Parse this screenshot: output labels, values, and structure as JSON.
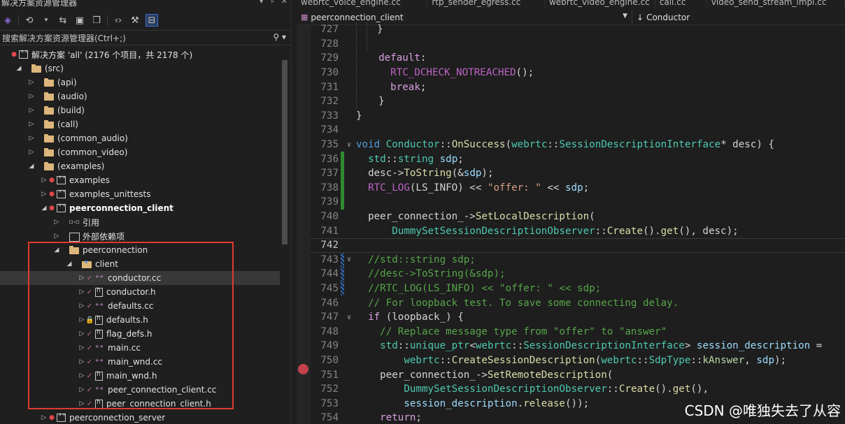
{
  "solution_explorer": {
    "title": "解决方案资源管理器",
    "window_buttons": [
      "▾",
      "♯",
      "✕"
    ],
    "search_placeholder": "搜索解决方案资源管理器(Ctrl+;)",
    "tree": [
      {
        "label": "解决方案 'all' (2176 个项目，共 2178 个)",
        "icon": "solution-icon",
        "status": "red",
        "arrow": "",
        "depth": 0
      },
      {
        "label": "(src)",
        "icon": "folder-icon",
        "status": "",
        "arrow": "open",
        "depth": 1
      },
      {
        "label": "(api)",
        "icon": "folder-icon",
        "status": "",
        "arrow": "closed",
        "depth": 2
      },
      {
        "label": "(audio)",
        "icon": "folder-icon",
        "status": "",
        "arrow": "closed",
        "depth": 2
      },
      {
        "label": "(build)",
        "icon": "folder-icon",
        "status": "",
        "arrow": "closed",
        "depth": 2
      },
      {
        "label": "(call)",
        "icon": "folder-icon",
        "status": "",
        "arrow": "closed",
        "depth": 2
      },
      {
        "label": "(common_audio)",
        "icon": "folder-icon",
        "status": "",
        "arrow": "closed",
        "depth": 2
      },
      {
        "label": "(common_video)",
        "icon": "folder-icon",
        "status": "",
        "arrow": "closed",
        "depth": 2
      },
      {
        "label": "(examples)",
        "icon": "folder-icon",
        "status": "",
        "arrow": "open",
        "depth": 2
      },
      {
        "label": "examples",
        "icon": "project-icon",
        "status": "red",
        "arrow": "closed",
        "depth": 3
      },
      {
        "label": "examples_unittests",
        "icon": "project-icon",
        "status": "red",
        "arrow": "closed",
        "depth": 3
      },
      {
        "label": "peerconnection_client",
        "icon": "project-icon",
        "status": "red",
        "arrow": "open",
        "depth": 3,
        "bold": true
      },
      {
        "label": "引用",
        "icon": "references-icon",
        "status": "",
        "arrow": "closed",
        "depth": 4
      },
      {
        "label": "外部依赖项",
        "icon": "external-deps-icon",
        "status": "",
        "arrow": "closed",
        "depth": 4
      },
      {
        "label": "peerconnection",
        "icon": "folder-icon",
        "status": "",
        "arrow": "open",
        "depth": 4
      },
      {
        "label": "client",
        "icon": "filter-folder-icon",
        "status": "",
        "arrow": "open",
        "depth": 5
      },
      {
        "label": "conductor.cc",
        "icon": "cpp-file-icon",
        "status": "check",
        "arrow": "closed",
        "depth": 6,
        "selected": true
      },
      {
        "label": "conductor.h",
        "icon": "header-file-icon",
        "status": "check",
        "arrow": "closed",
        "depth": 6
      },
      {
        "label": "defaults.cc",
        "icon": "cpp-file-icon",
        "status": "check",
        "arrow": "closed",
        "depth": 6
      },
      {
        "label": "defaults.h",
        "icon": "header-file-icon",
        "status": "lock",
        "arrow": "closed",
        "depth": 6
      },
      {
        "label": "flag_defs.h",
        "icon": "header-file-icon",
        "status": "check",
        "arrow": "closed",
        "depth": 6
      },
      {
        "label": "main.cc",
        "icon": "cpp-file-icon",
        "status": "check",
        "arrow": "closed",
        "depth": 6
      },
      {
        "label": "main_wnd.cc",
        "icon": "cpp-file-icon",
        "status": "check",
        "arrow": "closed",
        "depth": 6
      },
      {
        "label": "main_wnd.h",
        "icon": "header-file-icon",
        "status": "check",
        "arrow": "closed",
        "depth": 6
      },
      {
        "label": "peer_connection_client.cc",
        "icon": "cpp-file-icon",
        "status": "check",
        "arrow": "closed",
        "depth": 6
      },
      {
        "label": "peer_connection_client.h",
        "icon": "header-file-icon",
        "status": "check",
        "arrow": "closed",
        "depth": 6
      },
      {
        "label": "peerconnection_server",
        "icon": "project-icon",
        "status": "red",
        "arrow": "closed",
        "depth": 3
      }
    ]
  },
  "editor": {
    "tabs": [
      "webrtc_voice_engine.cc",
      "rtp_sender_egress.cc",
      "webrtc_video_engine.cc",
      "call.cc",
      "video_send_stream_impl.cc"
    ],
    "nav_project": "peerconnection_client",
    "nav_scope": "Conductor",
    "nav_scope_icon": "↓",
    "current_line": 742,
    "lines": [
      {
        "n": 727,
        "chg": "",
        "fold": "",
        "tokens": [
          [
            "gl",
            ""
          ],
          [
            "gl",
            ""
          ],
          [
            "pl",
            "}"
          ]
        ]
      },
      {
        "n": 728,
        "chg": "",
        "fold": "",
        "tokens": [
          [
            "gl",
            ""
          ],
          [
            "gl",
            ""
          ]
        ]
      },
      {
        "n": 729,
        "chg": "",
        "fold": "",
        "tokens": [
          [
            "gl",
            ""
          ],
          [
            "pl",
            "  "
          ],
          [
            "ctl",
            "default"
          ],
          [
            "pl",
            ":"
          ]
        ]
      },
      {
        "n": 730,
        "chg": "",
        "fold": "",
        "tokens": [
          [
            "gl",
            ""
          ],
          [
            "pl",
            "    "
          ],
          [
            "mac",
            "RTC_DCHECK_NOTREACHED"
          ],
          [
            "pl",
            "();"
          ]
        ]
      },
      {
        "n": 731,
        "chg": "",
        "fold": "",
        "tokens": [
          [
            "gl",
            ""
          ],
          [
            "pl",
            "    "
          ],
          [
            "ctl",
            "break"
          ],
          [
            "pl",
            ";"
          ]
        ]
      },
      {
        "n": 732,
        "chg": "",
        "fold": "",
        "tokens": [
          [
            "gl",
            ""
          ],
          [
            "pl",
            "  }"
          ]
        ]
      },
      {
        "n": 733,
        "chg": "",
        "fold": "",
        "tokens": [
          [
            "pl",
            "}"
          ]
        ]
      },
      {
        "n": 734,
        "chg": "",
        "fold": "",
        "tokens": []
      },
      {
        "n": 735,
        "chg": "",
        "fold": "v",
        "tokens": [
          [
            "kw",
            "void"
          ],
          [
            "pl",
            " "
          ],
          [
            "ty",
            "Conductor"
          ],
          [
            "pl",
            "::"
          ],
          [
            "fn",
            "OnSuccess"
          ],
          [
            "pl",
            "("
          ],
          [
            "ns",
            "webrtc"
          ],
          [
            "pl",
            "::"
          ],
          [
            "ty",
            "SessionDescriptionInterface"
          ],
          [
            "pl",
            "* desc) {"
          ]
        ]
      },
      {
        "n": 736,
        "chg": "green",
        "fold": "",
        "tokens": [
          [
            "pl",
            "  "
          ],
          [
            "ns",
            "std"
          ],
          [
            "pl",
            "::"
          ],
          [
            "ty",
            "string"
          ],
          [
            "pl",
            " "
          ],
          [
            "var",
            "sdp"
          ],
          [
            "pl",
            ";"
          ]
        ]
      },
      {
        "n": 737,
        "chg": "green",
        "fold": "",
        "tokens": [
          [
            "pl",
            "  desc->"
          ],
          [
            "fn",
            "ToString"
          ],
          [
            "pl",
            "(&"
          ],
          [
            "var",
            "sdp"
          ],
          [
            "pl",
            ");"
          ]
        ]
      },
      {
        "n": 738,
        "chg": "green",
        "fold": "",
        "tokens": [
          [
            "pl",
            "  "
          ],
          [
            "mac",
            "RTC_LOG"
          ],
          [
            "pl",
            "(LS_INFO) << "
          ],
          [
            "str",
            "\"offer: \""
          ],
          [
            "pl",
            " << "
          ],
          [
            "var",
            "sdp"
          ],
          [
            "pl",
            ";"
          ]
        ]
      },
      {
        "n": 739,
        "chg": "green",
        "fold": "",
        "tokens": []
      },
      {
        "n": 740,
        "chg": "",
        "fold": "",
        "tokens": [
          [
            "pl",
            "  peer_connection_->"
          ],
          [
            "fn",
            "SetLocalDescription"
          ],
          [
            "pl",
            "("
          ]
        ]
      },
      {
        "n": 741,
        "chg": "",
        "fold": "",
        "tokens": [
          [
            "pl",
            "      "
          ],
          [
            "ty",
            "DummySetSessionDescriptionObserver"
          ],
          [
            "pl",
            "::"
          ],
          [
            "fn",
            "Create"
          ],
          [
            "pl",
            "()."
          ],
          [
            "fn",
            "get"
          ],
          [
            "pl",
            "(), desc);"
          ]
        ]
      },
      {
        "n": 742,
        "chg": "",
        "fold": "",
        "tokens": []
      },
      {
        "n": 743,
        "chg": "blue",
        "fold": "v",
        "tokens": [
          [
            "pl",
            "  "
          ],
          [
            "cm",
            "//std::string sdp;"
          ]
        ]
      },
      {
        "n": 744,
        "chg": "blue",
        "fold": "",
        "tokens": [
          [
            "pl",
            "  "
          ],
          [
            "cm",
            "//desc->ToString(&sdp);"
          ]
        ]
      },
      {
        "n": 745,
        "chg": "blue",
        "fold": "",
        "tokens": [
          [
            "pl",
            "  "
          ],
          [
            "cm",
            "//RTC_LOG(LS_INFO) << \"offer: \" << sdp;"
          ]
        ]
      },
      {
        "n": 746,
        "chg": "",
        "fold": "",
        "tokens": [
          [
            "pl",
            "  "
          ],
          [
            "cm",
            "// For loopback test. To save some connecting delay."
          ]
        ]
      },
      {
        "n": 747,
        "chg": "",
        "fold": "v",
        "tokens": [
          [
            "pl",
            "  "
          ],
          [
            "ctl",
            "if"
          ],
          [
            "pl",
            " (loopback_) {"
          ]
        ]
      },
      {
        "n": 748,
        "chg": "",
        "fold": "",
        "tokens": [
          [
            "pl",
            "    "
          ],
          [
            "cm",
            "// Replace message type from \"offer\" to \"answer\""
          ]
        ]
      },
      {
        "n": 749,
        "chg": "",
        "fold": "",
        "tokens": [
          [
            "pl",
            "    "
          ],
          [
            "ns",
            "std"
          ],
          [
            "pl",
            "::"
          ],
          [
            "ty",
            "unique_ptr"
          ],
          [
            "pl",
            "<"
          ],
          [
            "ns",
            "webrtc"
          ],
          [
            "pl",
            "::"
          ],
          [
            "ty",
            "SessionDescriptionInterface"
          ],
          [
            "pl",
            "> "
          ],
          [
            "var",
            "session_description"
          ],
          [
            "pl",
            " ="
          ]
        ]
      },
      {
        "n": 750,
        "chg": "",
        "fold": "",
        "tokens": [
          [
            "pl",
            "        "
          ],
          [
            "ns",
            "webrtc"
          ],
          [
            "pl",
            "::"
          ],
          [
            "fn",
            "CreateSessionDescription"
          ],
          [
            "pl",
            "("
          ],
          [
            "ns",
            "webrtc"
          ],
          [
            "pl",
            "::"
          ],
          [
            "ty",
            "SdpType"
          ],
          [
            "pl",
            "::"
          ],
          [
            "en",
            "kAnswer"
          ],
          [
            "pl",
            ", "
          ],
          [
            "var",
            "sdp"
          ],
          [
            "pl",
            ");"
          ]
        ]
      },
      {
        "n": 751,
        "chg": "",
        "fold": "",
        "tokens": [
          [
            "pl",
            "    peer_connection_->"
          ],
          [
            "fn",
            "SetRemoteDescription"
          ],
          [
            "pl",
            "("
          ]
        ]
      },
      {
        "n": 752,
        "chg": "",
        "fold": "",
        "tokens": [
          [
            "pl",
            "        "
          ],
          [
            "ty",
            "DummySetSessionDescriptionObserver"
          ],
          [
            "pl",
            "::"
          ],
          [
            "fn",
            "Create"
          ],
          [
            "pl",
            "()."
          ],
          [
            "fn",
            "get"
          ],
          [
            "pl",
            "(),"
          ]
        ]
      },
      {
        "n": 753,
        "chg": "",
        "fold": "",
        "tokens": [
          [
            "pl",
            "        "
          ],
          [
            "var",
            "session_description"
          ],
          [
            "pl",
            "."
          ],
          [
            "fn",
            "release"
          ],
          [
            "pl",
            "());"
          ]
        ]
      },
      {
        "n": 754,
        "chg": "",
        "fold": "",
        "tokens": [
          [
            "pl",
            "    "
          ],
          [
            "ctl",
            "return"
          ],
          [
            "pl",
            ";"
          ]
        ]
      }
    ],
    "breakpoint_line": 749
  },
  "watermark": "CSDN @唯独失去了从容"
}
